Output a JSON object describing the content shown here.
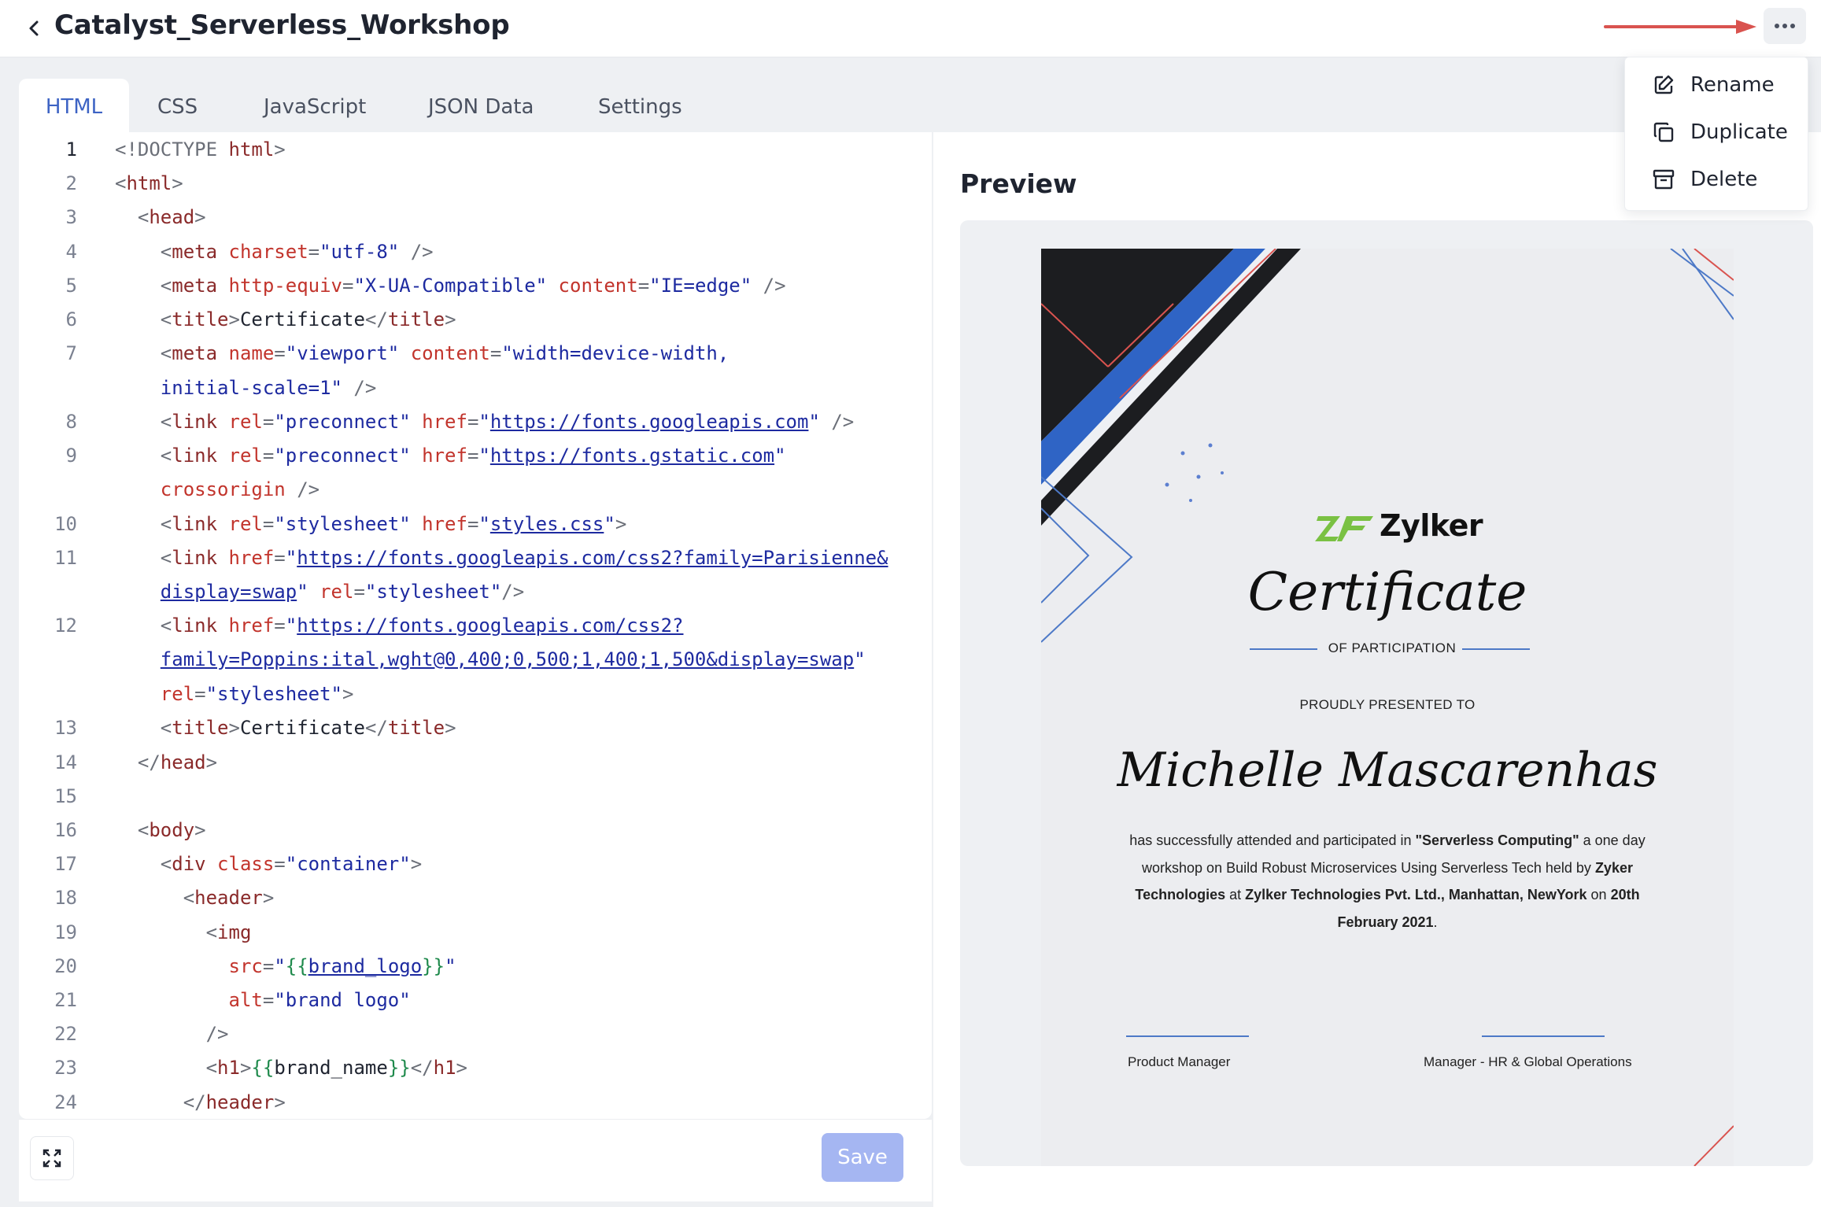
{
  "header": {
    "title": "Catalyst_Serverless_Workshop",
    "more_icon": "more-horizontal-icon",
    "back_icon": "chevron-left-icon"
  },
  "menu": {
    "items": [
      {
        "label": "Rename",
        "icon": "edit-icon"
      },
      {
        "label": "Duplicate",
        "icon": "copy-icon"
      },
      {
        "label": "Delete",
        "icon": "archive-icon"
      }
    ]
  },
  "tabs": [
    {
      "label": "HTML",
      "active": true
    },
    {
      "label": "CSS",
      "active": false
    },
    {
      "label": "JavaScript",
      "active": false
    },
    {
      "label": "JSON Data",
      "active": false
    },
    {
      "label": "Settings",
      "active": false
    }
  ],
  "editor": {
    "current_line": "1",
    "line_numbers": [
      "1",
      "2",
      "3",
      "4",
      "5",
      "6",
      "7",
      "8",
      "9",
      "10",
      "11",
      "12",
      "13",
      "14",
      "15",
      "16",
      "17",
      "18",
      "19",
      "20",
      "21",
      "22",
      "23",
      "24"
    ]
  },
  "footer": {
    "save_label": "Save",
    "expand_icon": "expand-icon"
  },
  "preview": {
    "title": "Preview",
    "certificate": {
      "brand": "Zylker",
      "title": "Certificate",
      "subtitle": "OF PARTICIPATION",
      "presented": "PROUDLY PRESENTED TO",
      "recipient": "Michelle Mascarenhas",
      "desc_1": "has successfully attended and participated in ",
      "desc_event": "\"Serverless Computing\"",
      "desc_2": " a one day workshop on Build Robust Microservices Using Serverless Tech held by ",
      "desc_org": "Zyker Technologies",
      "desc_3": " at ",
      "desc_venue": "Zylker Technologies Pvt. Ltd., Manhattan, NewYork",
      "desc_4": " on ",
      "desc_date": "20th February 2021",
      "desc_5": ".",
      "sig_left": "Product Manager",
      "sig_right": "Manager - HR & Global Operations"
    }
  },
  "colors": {
    "accent": "#3d63c4",
    "save_disabled": "#a5b6f2",
    "annotation_arrow": "#d9534f",
    "brand_green": "#7ac143"
  }
}
